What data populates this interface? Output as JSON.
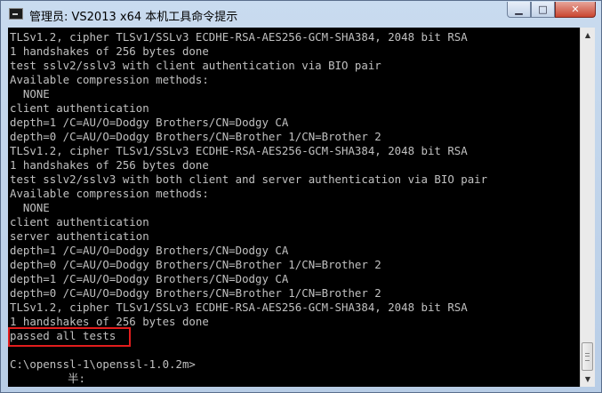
{
  "window": {
    "title": "管理员: VS2013 x64 本机工具命令提示",
    "buttons": {
      "minimize": "▁",
      "maximize": "□",
      "close": "✕"
    }
  },
  "console": {
    "lines": [
      "TLSv1.2, cipher TLSv1/SSLv3 ECDHE-RSA-AES256-GCM-SHA384, 2048 bit RSA",
      "1 handshakes of 256 bytes done",
      "test sslv2/sslv3 with client authentication via BIO pair",
      "Available compression methods:",
      "  NONE",
      "client authentication",
      "depth=1 /C=AU/O=Dodgy Brothers/CN=Dodgy CA",
      "depth=0 /C=AU/O=Dodgy Brothers/CN=Brother 1/CN=Brother 2",
      "TLSv1.2, cipher TLSv1/SSLv3 ECDHE-RSA-AES256-GCM-SHA384, 2048 bit RSA",
      "1 handshakes of 256 bytes done",
      "test sslv2/sslv3 with both client and server authentication via BIO pair",
      "Available compression methods:",
      "  NONE",
      "client authentication",
      "server authentication",
      "depth=1 /C=AU/O=Dodgy Brothers/CN=Dodgy CA",
      "depth=0 /C=AU/O=Dodgy Brothers/CN=Brother 1/CN=Brother 2",
      "depth=1 /C=AU/O=Dodgy Brothers/CN=Dodgy CA",
      "depth=0 /C=AU/O=Dodgy Brothers/CN=Brother 1/CN=Brother 2",
      "TLSv1.2, cipher TLSv1/SSLv3 ECDHE-RSA-AES256-GCM-SHA384, 2048 bit RSA",
      "1 handshakes of 256 bytes done",
      "passed all tests",
      "",
      "C:\\openssl-1\\openssl-1.0.2m>"
    ],
    "ime_status": "         半:"
  },
  "scrollbar": {
    "up": "▲",
    "down": "▼"
  },
  "colors": {
    "console_bg": "#000000",
    "console_text": "#c0c0c0",
    "highlight": "#e21d1d"
  }
}
